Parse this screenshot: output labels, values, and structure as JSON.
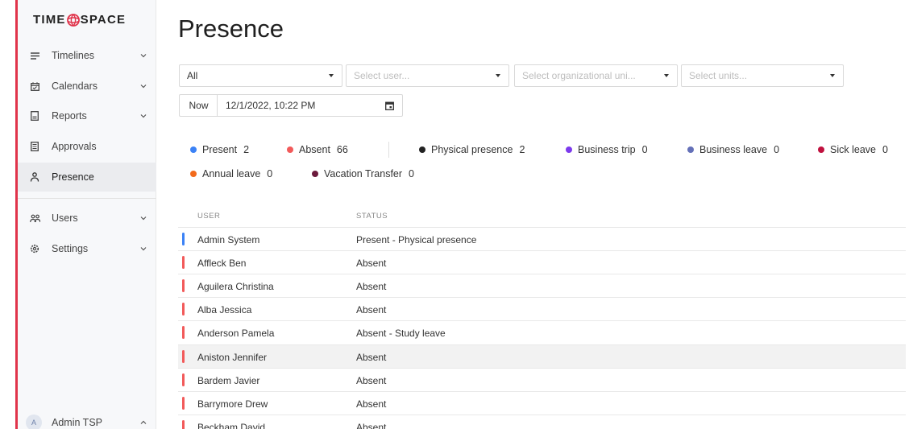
{
  "app": {
    "logo_left": "TIME",
    "logo_right": "SPACE"
  },
  "colors": {
    "brand": "#e0334a",
    "present": "#3b82f6",
    "absent": "#f25a5a"
  },
  "sidebar": {
    "items": [
      {
        "label": "Timelines",
        "icon": "timelines-icon",
        "expandable": true
      },
      {
        "label": "Calendars",
        "icon": "calendar-icon",
        "expandable": true
      },
      {
        "label": "Reports",
        "icon": "report-icon",
        "expandable": true
      },
      {
        "label": "Approvals",
        "icon": "approvals-icon",
        "expandable": false
      },
      {
        "label": "Presence",
        "icon": "presence-icon",
        "expandable": false,
        "active": true
      },
      {
        "label": "Users",
        "icon": "users-icon",
        "expandable": true
      },
      {
        "label": "Settings",
        "icon": "gear-icon",
        "expandable": true
      }
    ],
    "user": {
      "initial": "A",
      "name": "Admin TSP"
    }
  },
  "page": {
    "title": "Presence"
  },
  "filters": {
    "all": "All",
    "user_placeholder": "Select user...",
    "org_placeholder": "Select organizational uni...",
    "units_placeholder": "Select units...",
    "now_label": "Now",
    "datetime": "12/1/2022, 10:22 PM"
  },
  "legend": [
    {
      "label": "Present",
      "count": "2",
      "color": "#3b82f6"
    },
    {
      "label": "Absent",
      "count": "66",
      "color": "#f25a5a"
    },
    {
      "label": "Physical presence",
      "count": "2",
      "color": "#222222"
    },
    {
      "label": "Business trip",
      "count": "0",
      "color": "#7c3aed"
    },
    {
      "label": "Business leave",
      "count": "0",
      "color": "#6470b8"
    },
    {
      "label": "Sick leave",
      "count": "0",
      "color": "#c0113e"
    },
    {
      "label": "Annual leave",
      "count": "0",
      "color": "#f26a1b"
    },
    {
      "label": "Vacation Transfer",
      "count": "0",
      "color": "#6b1a3c"
    }
  ],
  "table": {
    "headers": {
      "user": "USER",
      "status": "STATUS"
    },
    "rows": [
      {
        "user": "Admin System",
        "status": "Present - Physical presence",
        "color": "#3b82f6"
      },
      {
        "user": "Affleck Ben",
        "status": "Absent",
        "color": "#f25a5a"
      },
      {
        "user": "Aguilera Christina",
        "status": "Absent",
        "color": "#f25a5a"
      },
      {
        "user": "Alba Jessica",
        "status": "Absent",
        "color": "#f25a5a"
      },
      {
        "user": "Anderson Pamela",
        "status": "Absent - Study leave",
        "color": "#f25a5a"
      },
      {
        "user": "Aniston Jennifer",
        "status": "Absent",
        "color": "#f25a5a"
      },
      {
        "user": "Bardem Javier",
        "status": "Absent",
        "color": "#f25a5a"
      },
      {
        "user": "Barrymore Drew",
        "status": "Absent",
        "color": "#f25a5a"
      },
      {
        "user": "Beckham David",
        "status": "Absent",
        "color": "#f25a5a"
      }
    ]
  }
}
